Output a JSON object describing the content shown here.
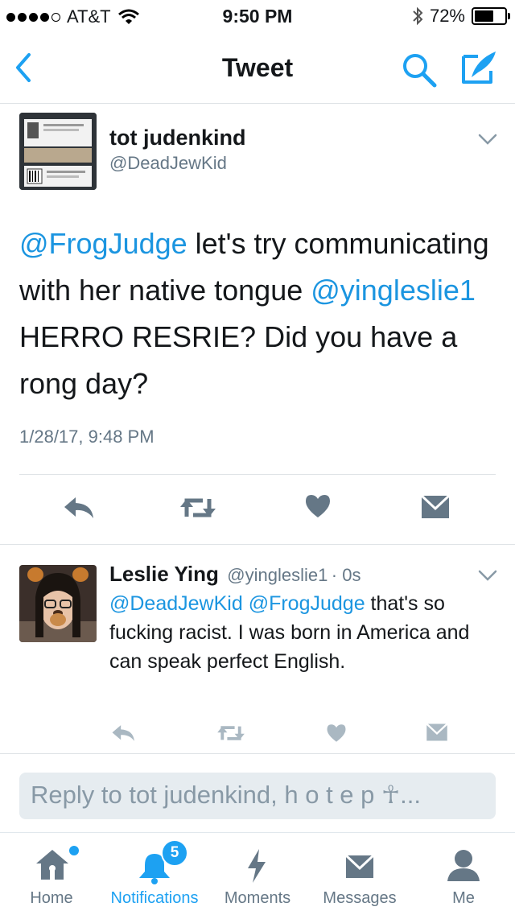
{
  "status_bar": {
    "carrier": "AT&T",
    "time": "9:50 PM",
    "battery": "72%",
    "battery_level": 0.72,
    "signal_bars": 4
  },
  "nav": {
    "title": "Tweet",
    "back_icon": "chevron-left-icon",
    "search_icon": "search-icon",
    "compose_icon": "compose-icon",
    "accent": "#1da1f2"
  },
  "tweet": {
    "name": "tot judenkind",
    "handle": "@DeadJewKid",
    "text_parts": {
      "mention1": "@FrogJudge",
      "t1": " let's try communicating with her native tongue ",
      "mention2": "@yingleslie1",
      "t2": " HERRO RESRIE? Did you have a rong day?"
    },
    "timestamp": "1/28/17, 9:48 PM",
    "actions": [
      "reply-icon",
      "retweet-icon",
      "like-icon",
      "message-icon"
    ]
  },
  "reply": {
    "name": "Leslie Ying",
    "handle": "@yingleslie1",
    "time": "· 0s",
    "text_parts": {
      "mention1": "@DeadJewKid",
      "mention2": "@FrogJudge",
      "t1": " that's so fucking racist. I was born in America and can speak perfect English."
    }
  },
  "reply_input": {
    "placeholder": "Reply to tot judenkind, h o t e p ☥..."
  },
  "tabbar": {
    "tabs": [
      {
        "label": "Home",
        "icon": "home-icon"
      },
      {
        "label": "Notifications",
        "icon": "bell-icon",
        "badge": "5"
      },
      {
        "label": "Moments",
        "icon": "lightning-icon"
      },
      {
        "label": "Messages",
        "icon": "envelope-icon"
      },
      {
        "label": "Me",
        "icon": "person-icon"
      }
    ],
    "active": "Notifications"
  }
}
